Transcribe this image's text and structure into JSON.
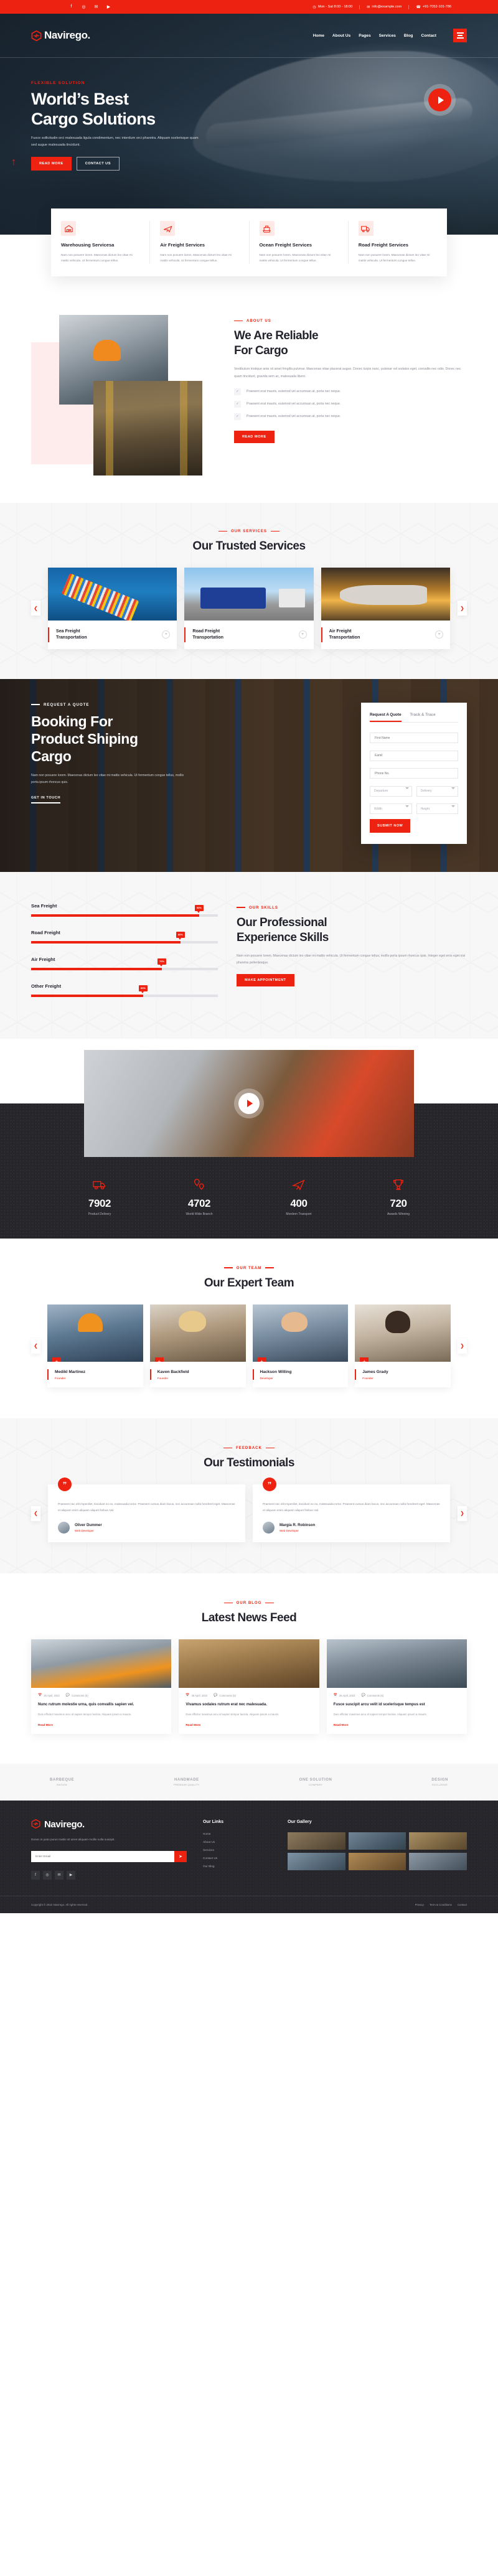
{
  "topbar": {
    "social": [
      "f",
      "◎",
      "✉",
      "▶"
    ],
    "hours_icon": "clock-icon",
    "hours": "Mon - Sat 8:00 - 18:00",
    "email_icon": "mail-icon",
    "email": "info@example.com",
    "phone_icon": "phone-icon",
    "phone": "+91-7052-101-786"
  },
  "header": {
    "logo_text": "Navirego.",
    "nav": [
      "Home",
      "About Us",
      "Pages",
      "Services",
      "Blog",
      "Contact"
    ],
    "menu_icon": "hamburger-icon"
  },
  "hero": {
    "kicker": "FLEXIBLE SOLUTION",
    "title_line1": "World’s Best",
    "title_line2": "Cargo Solutions",
    "desc": "Fusce sollicitudin orci malesuada ligula condimentum, nec interdum orci pharetra. Aliquam scelerisque quam sed augue malesuada tincidunt.",
    "btn_primary": "READ MORE",
    "btn_secondary": "CONTACT US",
    "play_icon": "play-icon"
  },
  "feature_cards": [
    {
      "icon": "warehouse-icon",
      "title": "Warehousing Servicesa",
      "desc": "Nam non posuere lorem. Maecenas dictum leo vitae mi mattis vehicula. Ut fermentum congue tellus."
    },
    {
      "icon": "airplane-icon",
      "title": "Air Freight Services",
      "desc": "Nam non posuere lorem. Maecenas dictum leo vitae mi mattis vehicula. Ut fermentum congue tellus."
    },
    {
      "icon": "ship-icon",
      "title": "Ocean Freight Services",
      "desc": "Nam non posuere lorem. Maecenas dictum leo vitae mi mattis vehicula. Ut fermentum congue tellus."
    },
    {
      "icon": "truck-icon",
      "title": "Road Freight Services",
      "desc": "Nam non posuere lorem. Maecenas dictum leo vitae mi mattis vehicula. Ut fermentum congue tellus."
    }
  ],
  "about": {
    "kicker": "ABOUT US",
    "title_line1": "We Are Reliable",
    "title_line2": "For Cargo",
    "paragraph": "Vestibulum tristique ante sit amet fringilla pulvinar. Maecenas vitae placerat augue. Donec turpis nunc, pulvinar vel sodales eget, convallis nec odio. Donec nec quam tincidunt, gravida sem ac, malesuada libero.",
    "checks": [
      "Praesent erat mauris, euismod vel accumsan at, porta nec neque.",
      "Praesent erat mauris, euismod vel accumsan at, porta nec neque.",
      "Praesent erat mauris, euismod vel accumsan at, porta nec neque."
    ],
    "button": "READ MORE"
  },
  "services": {
    "kicker": "OUR SERVICES",
    "title": "Our Trusted Services",
    "prev_icon": "chevron-left-icon",
    "next_icon": "chevron-right-icon",
    "items": [
      {
        "title_line1": "Sea Freight",
        "title_line2": "Transportation",
        "image": "container-ship-photo"
      },
      {
        "title_line1": "Road Freight",
        "title_line2": "Transportation",
        "image": "blue-truck-photo"
      },
      {
        "title_line1": "Air Freight",
        "title_line2": "Transportation",
        "image": "cargo-plane-photo"
      }
    ]
  },
  "booking": {
    "kicker": "REQUEST A QUOTE",
    "title_line1": "Booking For",
    "title_line2": "Product Shiping",
    "title_line3": "Cargo",
    "desc": "Nam non posuere lorem. Maecenas dictum leo vitae mi mattis vehicula. Ut fermentum congue tellus, mollis porta ipsum rhoncus quis.",
    "get_in_touch": "GET IN TOUCH",
    "form": {
      "tab_quote": "Request A Quote",
      "tab_track": "Track & Trace",
      "first_name_placeholder": "First Name",
      "email_placeholder": "Eamil",
      "phone_placeholder": "Phone No.",
      "departure_value": "Departure",
      "delivery_value": "Delivery",
      "width_value": "Width",
      "height_value": "Height",
      "submit": "SUBMIT NOW"
    }
  },
  "skills": {
    "kicker": "OUR SKILLS",
    "title_line1": "Our Professional",
    "title_line2": "Experience Skills",
    "paragraph": "Nam non posuere lorem. Maecenas dictum leo vitae mi mattis vehicula. Ut fermentum congue tellus, mollis porta ipsum rhoncus quis. Integer eget eros eget nisi pharetra pellentesque.",
    "button": "MAKE APPOINTMENT",
    "bars": [
      {
        "label": "Sea Freight",
        "value": 90,
        "display": "90%"
      },
      {
        "label": "Road Freight",
        "value": 80,
        "display": "80%"
      },
      {
        "label": "Air Freight",
        "value": 70,
        "display": "70%"
      },
      {
        "label": "Other Freight",
        "value": 60,
        "display": "60%"
      }
    ]
  },
  "video": {
    "play_icon": "play-icon",
    "image": "delivery-courier-photo"
  },
  "counters": [
    {
      "icon": "truck-icon",
      "number": "7902",
      "label": "Product Delivery"
    },
    {
      "icon": "location-pin-icon",
      "number": "4702",
      "label": "World Wide Branch"
    },
    {
      "icon": "airplane-icon",
      "number": "400",
      "label": "Mordern Transport"
    },
    {
      "icon": "trophy-icon",
      "number": "720",
      "label": "Awards Winning"
    }
  ],
  "team": {
    "kicker": "OUR TEAM",
    "title": "Our Expert Team",
    "prev_icon": "chevron-left-icon",
    "next_icon": "chevron-right-icon",
    "members": [
      {
        "name": "Medikl Martinez",
        "role": "Founder",
        "plus_icon": "plus-icon"
      },
      {
        "name": "Kaven Backfield",
        "role": "Founder",
        "plus_icon": "plus-icon"
      },
      {
        "name": "Hackson Willing",
        "role": "Developer",
        "plus_icon": "plus-icon"
      },
      {
        "name": "James Grady",
        "role": "Founder",
        "plus_icon": "plus-icon"
      }
    ]
  },
  "testimonials": {
    "kicker": "FEEDBACK",
    "title": "Our Testimonials",
    "prev_icon": "chevron-left-icon",
    "next_icon": "chevron-right-icon",
    "quote_mark": "”",
    "items": [
      {
        "text": "Praesent nec elit imperdiet, tincidunt ex eu, malesuada tortor. Praesent cursus diam lacus, nec accumsan nulla hendrerit eget. Maecenas et aliquam enim aliquam aliquet finibus nisl.",
        "name": "Oliver Dummer",
        "role": "Web Developer"
      },
      {
        "text": "Praesent nec elit imperdiet, tincidunt ex eu, malesuada tortor. Praesent cursus diam lacus, nec accumsan nulla hendrerit eget. Maecenas et aliquam enim aliquam aliquet finibus nisl.",
        "name": "Margia R. Robinson",
        "role": "Web Developer"
      }
    ]
  },
  "blog": {
    "kicker": "OUR BLOG",
    "title": "Latest News Feed",
    "posts": [
      {
        "date": "26 April, 2022",
        "comments": "Comments (5)",
        "title": "Nunc rutrum molestie urna, quis convallis sapien vel.",
        "excerpt": "Duis efficitur maximus arcu id sapien tempor lacinia. Aliquam ipsum a mauris.",
        "read_more": "Read More"
      },
      {
        "date": "26 April, 2022",
        "comments": "Comments (5)",
        "title": "Vivamus sodales rutrum erat nec malesuada.",
        "excerpt": "Duis efficitur maximus arcu id sapien tempor lacinia. Aliquam ipsum a mauris.",
        "read_more": "Read More"
      },
      {
        "date": "26 April, 2022",
        "comments": "Comments (5)",
        "title": "Fusce suscipit arcu velit id scelerisque tempus est",
        "excerpt": "Duis efficitur maximus arcu id sapien tempor lacinia. Aliquam ipsum a mauris.",
        "read_more": "Read More"
      }
    ],
    "date_icon": "calendar-icon",
    "comment_icon": "comment-icon"
  },
  "brands": [
    {
      "name": "BARBEQUE",
      "sub": "NATION"
    },
    {
      "name": "HANDMADE",
      "sub": "PREMIUM QUALITY"
    },
    {
      "name": "ONE SOLUTION",
      "sub": "COMPANY"
    },
    {
      "name": "DESIGN",
      "sub": "EXCLUSIVE"
    }
  ],
  "footer": {
    "logo_text": "Navirego.",
    "about": "Donec in justo purus mattis sit amet aliquam mollis nulla suscipit.",
    "email_placeholder": "Enter Email",
    "submit_icon": "send-icon",
    "social": [
      "f",
      "◎",
      "✉",
      "▶"
    ],
    "links_title": "Our Links",
    "links": [
      "Home",
      "About Us",
      "Services",
      "Contact Us",
      "Our Blog"
    ],
    "gallery_title": "Our Gallery",
    "gallery": [
      "warehouse-thumb-1",
      "warehouse-thumb-2",
      "warehouse-thumb-3",
      "warehouse-thumb-4",
      "warehouse-thumb-5",
      "warehouse-thumb-6"
    ],
    "copyright_pre": "Copyright © 2022 Navirego. All rights reserved.",
    "legal": [
      "Privacy",
      "Term & Conditions",
      "Contact"
    ]
  },
  "colors": {
    "accent": "#ee2211",
    "dark": "#26262b",
    "muted": "#8b8b96"
  }
}
